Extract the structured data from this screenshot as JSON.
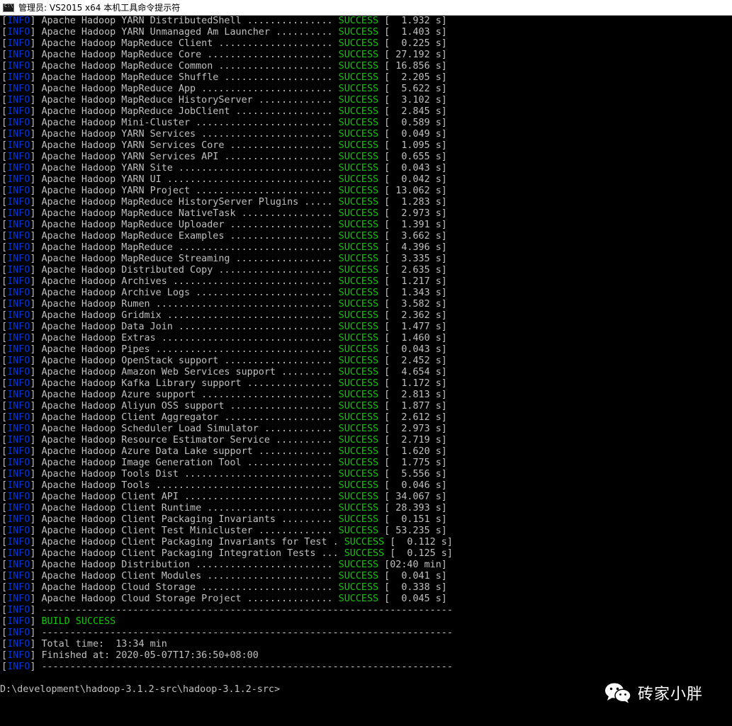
{
  "window": {
    "title": "管理员: VS2015 x64 本机工具命令提示符"
  },
  "colors": {
    "background": "#000000",
    "text": "#c0c0c0",
    "info_tag": "#0037da",
    "success": "#16c60c"
  },
  "info_tag": "INFO",
  "modules": [
    {
      "name": "Apache Hadoop YARN DistributedShell ...............",
      "status": "SUCCESS",
      "time": "[  1.932 s]"
    },
    {
      "name": "Apache Hadoop YARN Unmanaged Am Launcher ..........",
      "status": "SUCCESS",
      "time": "[  1.403 s]"
    },
    {
      "name": "Apache Hadoop MapReduce Client ....................",
      "status": "SUCCESS",
      "time": "[  0.225 s]"
    },
    {
      "name": "Apache Hadoop MapReduce Core ......................",
      "status": "SUCCESS",
      "time": "[ 27.192 s]"
    },
    {
      "name": "Apache Hadoop MapReduce Common ....................",
      "status": "SUCCESS",
      "time": "[ 16.856 s]"
    },
    {
      "name": "Apache Hadoop MapReduce Shuffle ...................",
      "status": "SUCCESS",
      "time": "[  2.205 s]"
    },
    {
      "name": "Apache Hadoop MapReduce App .......................",
      "status": "SUCCESS",
      "time": "[  5.622 s]"
    },
    {
      "name": "Apache Hadoop MapReduce HistoryServer .............",
      "status": "SUCCESS",
      "time": "[  3.102 s]"
    },
    {
      "name": "Apache Hadoop MapReduce JobClient .................",
      "status": "SUCCESS",
      "time": "[  2.845 s]"
    },
    {
      "name": "Apache Hadoop Mini-Cluster ........................",
      "status": "SUCCESS",
      "time": "[  0.589 s]"
    },
    {
      "name": "Apache Hadoop YARN Services .......................",
      "status": "SUCCESS",
      "time": "[  0.049 s]"
    },
    {
      "name": "Apache Hadoop YARN Services Core ..................",
      "status": "SUCCESS",
      "time": "[  1.095 s]"
    },
    {
      "name": "Apache Hadoop YARN Services API ...................",
      "status": "SUCCESS",
      "time": "[  0.655 s]"
    },
    {
      "name": "Apache Hadoop YARN Site ...........................",
      "status": "SUCCESS",
      "time": "[  0.043 s]"
    },
    {
      "name": "Apache Hadoop YARN UI .............................",
      "status": "SUCCESS",
      "time": "[  0.042 s]"
    },
    {
      "name": "Apache Hadoop YARN Project ........................",
      "status": "SUCCESS",
      "time": "[ 13.062 s]"
    },
    {
      "name": "Apache Hadoop MapReduce HistoryServer Plugins .....",
      "status": "SUCCESS",
      "time": "[  1.283 s]"
    },
    {
      "name": "Apache Hadoop MapReduce NativeTask ................",
      "status": "SUCCESS",
      "time": "[  2.973 s]"
    },
    {
      "name": "Apache Hadoop MapReduce Uploader ..................",
      "status": "SUCCESS",
      "time": "[  1.391 s]"
    },
    {
      "name": "Apache Hadoop MapReduce Examples ..................",
      "status": "SUCCESS",
      "time": "[  3.662 s]"
    },
    {
      "name": "Apache Hadoop MapReduce ...........................",
      "status": "SUCCESS",
      "time": "[  4.396 s]"
    },
    {
      "name": "Apache Hadoop MapReduce Streaming .................",
      "status": "SUCCESS",
      "time": "[  3.335 s]"
    },
    {
      "name": "Apache Hadoop Distributed Copy ....................",
      "status": "SUCCESS",
      "time": "[  2.635 s]"
    },
    {
      "name": "Apache Hadoop Archives ............................",
      "status": "SUCCESS",
      "time": "[  1.217 s]"
    },
    {
      "name": "Apache Hadoop Archive Logs ........................",
      "status": "SUCCESS",
      "time": "[  1.343 s]"
    },
    {
      "name": "Apache Hadoop Rumen ...............................",
      "status": "SUCCESS",
      "time": "[  3.582 s]"
    },
    {
      "name": "Apache Hadoop Gridmix .............................",
      "status": "SUCCESS",
      "time": "[  2.362 s]"
    },
    {
      "name": "Apache Hadoop Data Join ...........................",
      "status": "SUCCESS",
      "time": "[  1.477 s]"
    },
    {
      "name": "Apache Hadoop Extras ..............................",
      "status": "SUCCESS",
      "time": "[  1.460 s]"
    },
    {
      "name": "Apache Hadoop Pipes ...............................",
      "status": "SUCCESS",
      "time": "[  0.043 s]"
    },
    {
      "name": "Apache Hadoop OpenStack support ...................",
      "status": "SUCCESS",
      "time": "[  2.452 s]"
    },
    {
      "name": "Apache Hadoop Amazon Web Services support .........",
      "status": "SUCCESS",
      "time": "[  4.654 s]"
    },
    {
      "name": "Apache Hadoop Kafka Library support ...............",
      "status": "SUCCESS",
      "time": "[  1.172 s]"
    },
    {
      "name": "Apache Hadoop Azure support .......................",
      "status": "SUCCESS",
      "time": "[  2.813 s]"
    },
    {
      "name": "Apache Hadoop Aliyun OSS support ..................",
      "status": "SUCCESS",
      "time": "[  1.877 s]"
    },
    {
      "name": "Apache Hadoop Client Aggregator ...................",
      "status": "SUCCESS",
      "time": "[  2.612 s]"
    },
    {
      "name": "Apache Hadoop Scheduler Load Simulator ............",
      "status": "SUCCESS",
      "time": "[  2.973 s]"
    },
    {
      "name": "Apache Hadoop Resource Estimator Service ..........",
      "status": "SUCCESS",
      "time": "[  2.719 s]"
    },
    {
      "name": "Apache Hadoop Azure Data Lake support .............",
      "status": "SUCCESS",
      "time": "[  1.620 s]"
    },
    {
      "name": "Apache Hadoop Image Generation Tool ...............",
      "status": "SUCCESS",
      "time": "[  1.775 s]"
    },
    {
      "name": "Apache Hadoop Tools Dist ..........................",
      "status": "SUCCESS",
      "time": "[  5.556 s]"
    },
    {
      "name": "Apache Hadoop Tools ...............................",
      "status": "SUCCESS",
      "time": "[  0.046 s]"
    },
    {
      "name": "Apache Hadoop Client API ..........................",
      "status": "SUCCESS",
      "time": "[ 34.067 s]"
    },
    {
      "name": "Apache Hadoop Client Runtime ......................",
      "status": "SUCCESS",
      "time": "[ 28.393 s]"
    },
    {
      "name": "Apache Hadoop Client Packaging Invariants .........",
      "status": "SUCCESS",
      "time": "[  0.151 s]"
    },
    {
      "name": "Apache Hadoop Client Test Minicluster .............",
      "status": "SUCCESS",
      "time": "[ 53.235 s]"
    },
    {
      "name": "Apache Hadoop Client Packaging Invariants for Test .",
      "status": "SUCCESS",
      "time": "[  0.112 s]"
    },
    {
      "name": "Apache Hadoop Client Packaging Integration Tests ...",
      "status": "SUCCESS",
      "time": "[  0.125 s]"
    },
    {
      "name": "Apache Hadoop Distribution ........................",
      "status": "SUCCESS",
      "time": "[02:40 min]"
    },
    {
      "name": "Apache Hadoop Client Modules ......................",
      "status": "SUCCESS",
      "time": "[  0.041 s]"
    },
    {
      "name": "Apache Hadoop Cloud Storage .......................",
      "status": "SUCCESS",
      "time": "[  0.338 s]"
    },
    {
      "name": "Apache Hadoop Cloud Storage Project ...............",
      "status": "SUCCESS",
      "time": "[  0.045 s]"
    }
  ],
  "separator": "------------------------------------------------------------------------",
  "build_result": "BUILD SUCCESS",
  "total_time": "Total time:  13:34 min",
  "finished_at": "Finished at: 2020-05-07T17:36:50+08:00",
  "prompt": "D:\\development\\hadoop-3.1.2-src\\hadoop-3.1.2-src>",
  "watermark": {
    "text": "砖家小胖",
    "icon": "wechat-icon"
  }
}
